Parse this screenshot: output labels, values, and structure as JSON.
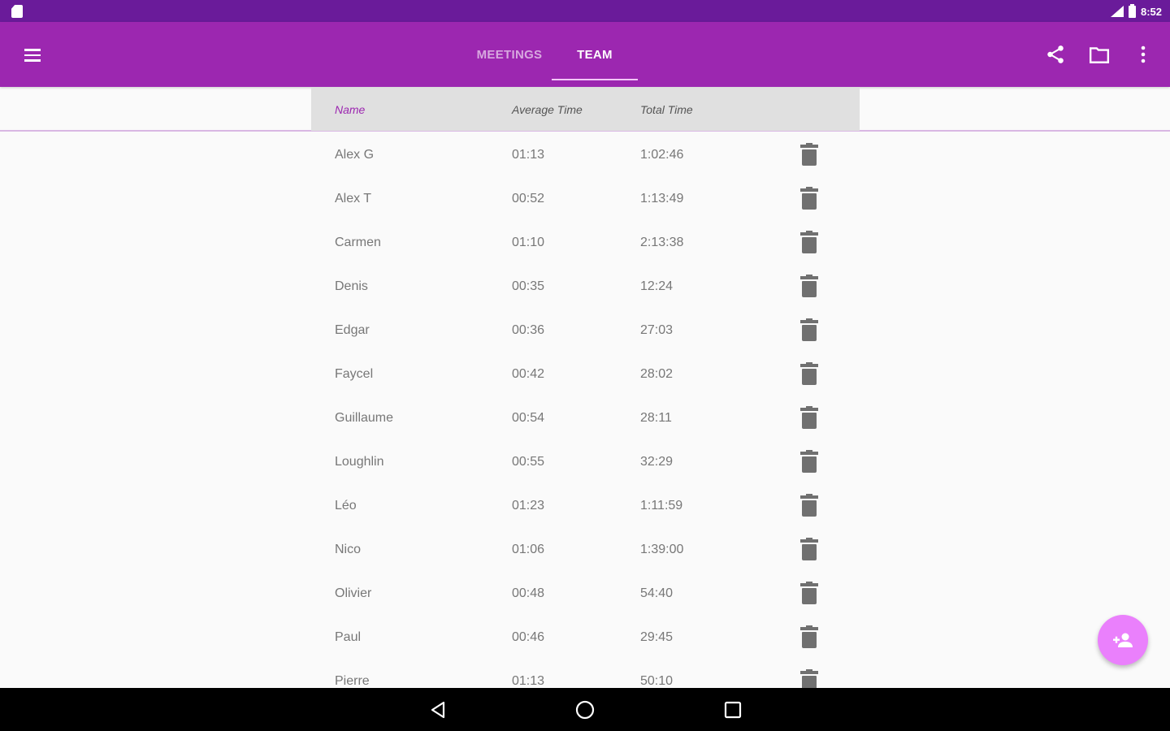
{
  "status_bar": {
    "time": "8:52"
  },
  "tabs": [
    {
      "label": "MEETINGS",
      "active": false
    },
    {
      "label": "TEAM",
      "active": true
    }
  ],
  "table": {
    "headers": {
      "name": "Name",
      "average": "Average Time",
      "total": "Total Time"
    },
    "rows": [
      {
        "name": "Alex G",
        "average": "01:13",
        "total": "1:02:46"
      },
      {
        "name": "Alex T",
        "average": "00:52",
        "total": "1:13:49"
      },
      {
        "name": "Carmen",
        "average": "01:10",
        "total": "2:13:38"
      },
      {
        "name": "Denis",
        "average": "00:35",
        "total": "12:24"
      },
      {
        "name": "Edgar",
        "average": "00:36",
        "total": "27:03"
      },
      {
        "name": "Faycel",
        "average": "00:42",
        "total": "28:02"
      },
      {
        "name": "Guillaume",
        "average": "00:54",
        "total": "28:11"
      },
      {
        "name": "Loughlin",
        "average": "00:55",
        "total": "32:29"
      },
      {
        "name": "Léo",
        "average": "01:23",
        "total": "1:11:59"
      },
      {
        "name": "Nico",
        "average": "01:06",
        "total": "1:39:00"
      },
      {
        "name": "Olivier",
        "average": "00:48",
        "total": "54:40"
      },
      {
        "name": "Paul",
        "average": "00:46",
        "total": "29:45"
      },
      {
        "name": "Pierre",
        "average": "01:13",
        "total": "50:10"
      }
    ]
  },
  "colors": {
    "primary": "#9c27b0",
    "primary_dark": "#6a1b9a",
    "accent": "#ea80fc"
  }
}
